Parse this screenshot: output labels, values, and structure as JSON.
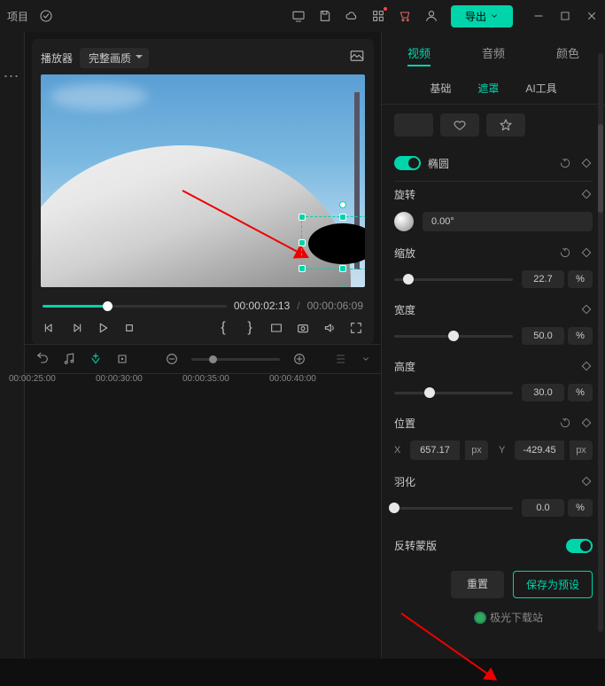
{
  "topbar": {
    "project_label": "项目",
    "export_label": "导出"
  },
  "player": {
    "label": "播放器",
    "quality": "完整画质",
    "current_time": "00:00:02:13",
    "total_time": "00:00:06:09"
  },
  "timeline": {
    "ticks": [
      "00:00:25:00",
      "00:00:30:00",
      "00:00:35:00",
      "00:00:40:00"
    ]
  },
  "inspector": {
    "tabs": {
      "video": "视频",
      "audio": "音频",
      "color": "颜色"
    },
    "subtabs": {
      "basic": "基础",
      "mask": "遮罩",
      "ai": "AI工具"
    },
    "ellipse_label": "椭圆",
    "rotation": {
      "label": "旋转",
      "value": "0.00°"
    },
    "scale": {
      "label": "缩放",
      "value": "22.7",
      "unit": "%"
    },
    "width": {
      "label": "宽度",
      "value": "50.0",
      "unit": "%"
    },
    "height": {
      "label": "高度",
      "value": "30.0",
      "unit": "%"
    },
    "position": {
      "label": "位置",
      "x_label": "X",
      "x_value": "657.17",
      "x_unit": "px",
      "y_label": "Y",
      "y_value": "-429.45",
      "y_unit": "px"
    },
    "feather": {
      "label": "羽化",
      "value": "0.0",
      "unit": "%"
    },
    "invert": {
      "label": "反转蒙版"
    },
    "reset_label": "重置",
    "save_preset_label": "保存为预设"
  },
  "watermark": "极光下载站"
}
